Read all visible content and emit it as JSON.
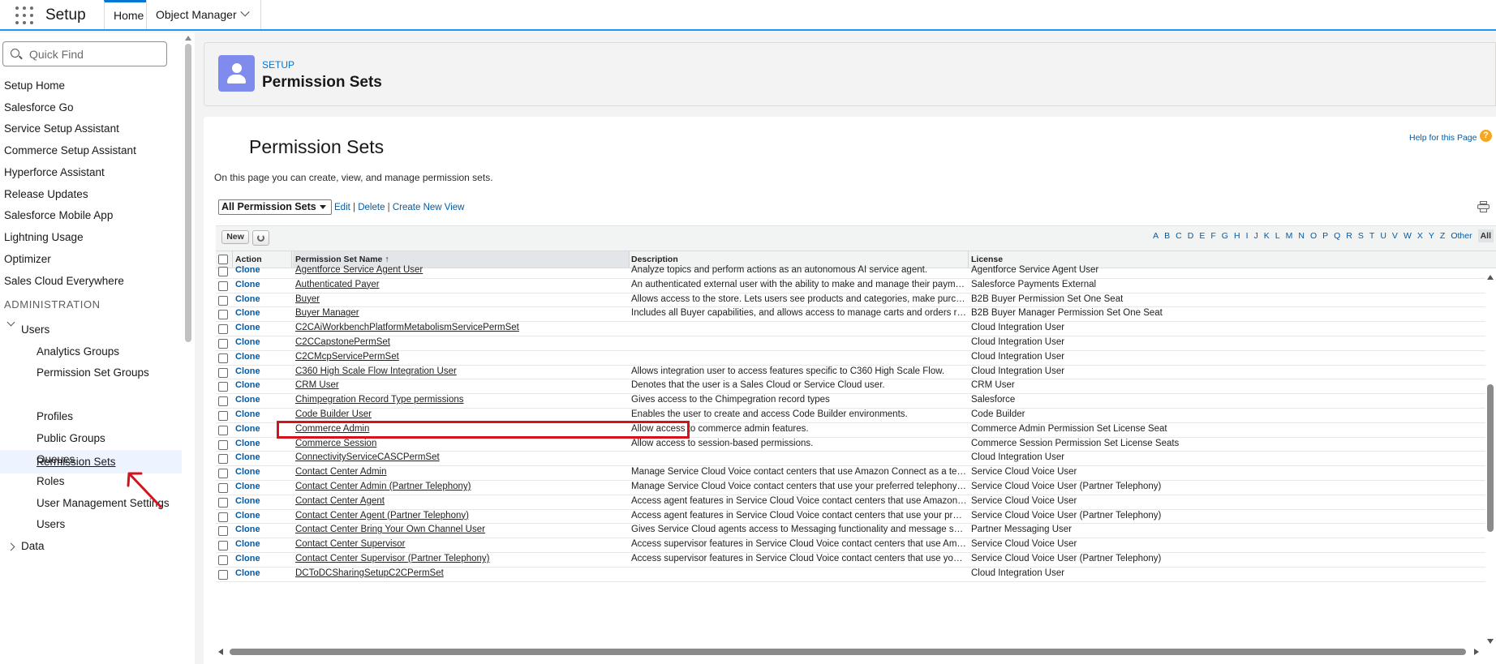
{
  "topbar": {
    "app_title": "Setup",
    "tabs": [
      {
        "label": "Home",
        "active": true
      },
      {
        "label": "Object Manager",
        "has_dropdown": true
      }
    ]
  },
  "sidebar": {
    "quick_find_placeholder": "Quick Find",
    "items": [
      "Setup Home",
      "Salesforce Go",
      "Service Setup Assistant",
      "Commerce Setup Assistant",
      "Hyperforce Assistant",
      "Release Updates",
      "Salesforce Mobile App",
      "Lightning Usage",
      "Optimizer",
      "Sales Cloud Everywhere"
    ],
    "section": "ADMINISTRATION",
    "users_group": {
      "label": "Users",
      "expanded": true,
      "children": [
        "Analytics Groups",
        "Permission Set Groups",
        "Permission Sets",
        "Profiles",
        "Public Groups",
        "Queues",
        "Roles",
        "User Management Settings",
        "Users"
      ],
      "active_child": "Permission Sets"
    },
    "data_group": {
      "label": "Data",
      "expanded": false
    }
  },
  "header": {
    "breadcrumb": "SETUP",
    "title": "Permission Sets",
    "icon": "user-icon",
    "icon_color": "#7f8ced"
  },
  "content": {
    "heading": "Permission Sets",
    "help_link": "Help for this Page",
    "description": "On this page you can create, view, and manage permission sets.",
    "view_select": "All Permission Sets",
    "view_links": {
      "edit": "Edit",
      "delete": "Delete",
      "create": "Create New View"
    },
    "new_button": "New",
    "alphabet": [
      "A",
      "B",
      "C",
      "D",
      "E",
      "F",
      "G",
      "H",
      "I",
      "J",
      "K",
      "L",
      "M",
      "N",
      "O",
      "P",
      "Q",
      "R",
      "S",
      "T",
      "U",
      "V",
      "W",
      "X",
      "Y",
      "Z",
      "Other",
      "All"
    ],
    "alphabet_selected": "All",
    "columns": {
      "action": "Action",
      "name": "Permission Set Name",
      "name_sort": "↑",
      "description": "Description",
      "license": "License"
    },
    "rows": [
      {
        "action": "Clone",
        "name": "Agentforce Service Agent User",
        "description": "Analyze topics and perform actions as an autonomous AI service agent.",
        "license": "Agentforce Service Agent User"
      },
      {
        "action": "Clone",
        "name": "Authenticated Payer",
        "description": "An authenticated external user with the ability to make and manage their payments.",
        "license": "Salesforce Payments External"
      },
      {
        "action": "Clone",
        "name": "Buyer",
        "description": "Allows access to the store. Lets users see products and categories, make purchases, and ad...",
        "license": "B2B Buyer Permission Set One Seat"
      },
      {
        "action": "Clone",
        "name": "Buyer Manager",
        "description": "Includes all Buyer capabilities, and allows access to manage carts and orders related to their ...",
        "license": "B2B Buyer Manager Permission Set One Seat"
      },
      {
        "action": "Clone",
        "name": "C2CAiWorkbenchPlatformMetabolismServicePermSet",
        "description": "",
        "license": "Cloud Integration User"
      },
      {
        "action": "Clone",
        "name": "C2CCapstonePermSet",
        "description": "",
        "license": "Cloud Integration User"
      },
      {
        "action": "Clone",
        "name": "C2CMcpServicePermSet",
        "description": "",
        "license": "Cloud Integration User"
      },
      {
        "action": "Clone",
        "name": "C360 High Scale Flow Integration User",
        "description": "Allows integration user to access features specific to C360 High Scale Flow.",
        "license": "Cloud Integration User"
      },
      {
        "action": "Clone",
        "name": "CRM User",
        "description": "Denotes that the user is a Sales Cloud or Service Cloud user.",
        "license": "CRM User"
      },
      {
        "action": "Clone",
        "name": "Chimpegration Record Type permissions",
        "description": "Gives access to the Chimpegration record types",
        "license": "Salesforce",
        "highlighted": true
      },
      {
        "action": "Clone",
        "name": "Code Builder User",
        "description": "Enables the user to create and access Code Builder environments.",
        "license": "Code Builder"
      },
      {
        "action": "Clone",
        "name": "Commerce Admin",
        "description": "Allow access to commerce admin features.",
        "license": "Commerce Admin Permission Set License Seat"
      },
      {
        "action": "Clone",
        "name": "Commerce Session",
        "description": "Allow access to session-based permissions.",
        "license": "Commerce Session Permission Set License Seats"
      },
      {
        "action": "Clone",
        "name": "ConnectivityServiceCASCPermSet",
        "description": "",
        "license": "Cloud Integration User"
      },
      {
        "action": "Clone",
        "name": "Contact Center Admin",
        "description": "Manage Service Cloud Voice contact centers that use Amazon Connect as a telephony pro...",
        "license": "Service Cloud Voice User"
      },
      {
        "action": "Clone",
        "name": "Contact Center Admin (Partner Telephony)",
        "description": "Manage Service Cloud Voice contact centers that use your preferred telephony provider.",
        "license": "Service Cloud Voice User (Partner Telephony)"
      },
      {
        "action": "Clone",
        "name": "Contact Center Agent",
        "description": "Access agent features in Service Cloud Voice contact centers that use Amazon Connect as...",
        "license": "Service Cloud Voice User"
      },
      {
        "action": "Clone",
        "name": "Contact Center Agent (Partner Telephony)",
        "description": "Access agent features in Service Cloud Voice contact centers that use your preferred telep...",
        "license": "Service Cloud Voice User (Partner Telephony)"
      },
      {
        "action": "Clone",
        "name": "Contact Center Bring Your Own Channel User",
        "description": "Gives Service Cloud agents access to Messaging functionality and message session recor...",
        "license": "Partner Messaging User"
      },
      {
        "action": "Clone",
        "name": "Contact Center Supervisor",
        "description": "Access supervisor features in Service Cloud Voice contact centers that use Amazon Conne...",
        "license": "Service Cloud Voice User"
      },
      {
        "action": "Clone",
        "name": "Contact Center Supervisor (Partner Telephony)",
        "description": "Access supervisor features in Service Cloud Voice contact centers that use your preferred tel...",
        "license": "Service Cloud Voice User (Partner Telephony)"
      },
      {
        "action": "Clone",
        "name": "DCToDCSharingSetupC2CPermSet",
        "description": "",
        "license": "Cloud Integration User"
      }
    ]
  },
  "colors": {
    "accent": "#0176d3",
    "link": "#015ba7",
    "highlight_box": "#d4141c",
    "annotation_arrow": "#d4141c"
  }
}
